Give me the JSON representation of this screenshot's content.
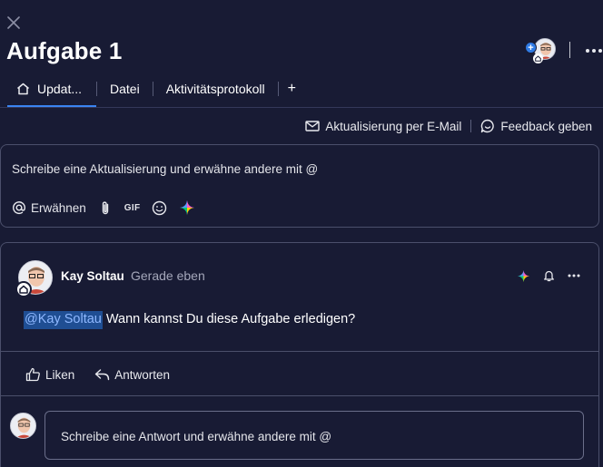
{
  "header": {
    "title": "Aufgabe 1"
  },
  "tabs": [
    {
      "label": "Updat..."
    },
    {
      "label": "Datei"
    },
    {
      "label": "Aktivitätsprotokoll"
    },
    {
      "label": "+"
    }
  ],
  "actions": {
    "email_label": "Aktualisierung per E-Mail",
    "feedback_label": "Feedback geben"
  },
  "composer": {
    "placeholder": "Schreibe eine Aktualisierung und erwähne andere mit @",
    "mention_label": "Erwähnen",
    "gif_label": "GIF"
  },
  "post": {
    "author": "Kay Soltau",
    "time": "Gerade eben",
    "mention": "@Kay Soltau",
    "body": " Wann kannst Du diese Aufgabe erledigen?",
    "like_label": "Liken",
    "reply_label": "Antworten"
  },
  "reply": {
    "placeholder": "Schreibe eine Antwort und erwähne andere mit @"
  },
  "colors": {
    "background": "#181b34",
    "accent": "#3a84f2",
    "mention_bg": "#1f4e93",
    "border": "#4b4f6b"
  },
  "icons": {
    "close": "close-icon",
    "more": "more-horizontal-icon",
    "home": "home-icon",
    "mail": "mail-icon",
    "feedback": "feedback-icon",
    "at": "at-icon",
    "attach": "paperclip-icon",
    "emoji": "smiley-icon",
    "ai": "ai-sparkle-icon",
    "bell": "bell-icon",
    "like": "thumbs-up-icon",
    "reply": "reply-icon"
  }
}
